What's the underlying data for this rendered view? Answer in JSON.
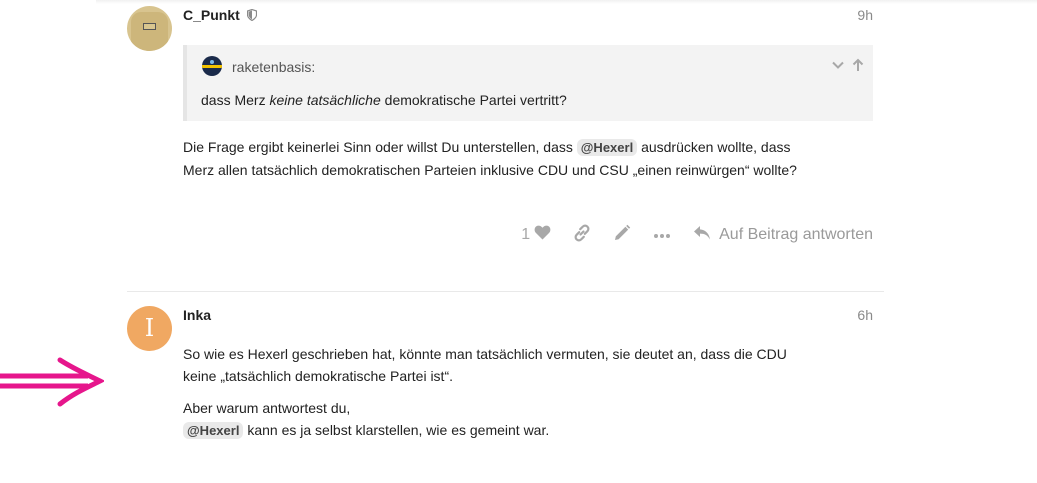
{
  "posts": [
    {
      "username": "C_Punkt",
      "time": "9h",
      "quote": {
        "author": "raketenbasis:",
        "text_before": "dass Merz ",
        "text_italic": "keine tatsächliche",
        "text_after": " demokratische Partei vertritt?"
      },
      "body": {
        "part1": "Die Frage ergibt keinerlei Sinn oder willst Du unterstellen, dass ",
        "mention": "@Hexerl",
        "part2": " ausdrücken wollte, dass",
        "line2": "Merz allen tatsächlich demokratischen Parteien inklusive CDU und CSU „einen reinwürgen“ wollte?"
      },
      "actions": {
        "like_count": "1",
        "reply_label": "Auf Beitrag antworten"
      }
    },
    {
      "username": "Inka",
      "avatar_letter": "I",
      "time": "6h",
      "body": {
        "para1_line1": "So wie es Hexerl geschrieben hat, könnte man tatsächlich vermuten, sie deutet an, dass die CDU",
        "para1_line2": "keine „tatsächlich demokratische Partei ist“.",
        "para2_line1": "Aber warum antwortest du,",
        "mention": "@Hexerl",
        "para2_line2_rest": " kann es ja selbst klarstellen, wie es gemeint war."
      }
    }
  ],
  "colors": {
    "accent_arrow": "#e6168c",
    "inka_avatar": "#f0a862",
    "muted": "#a8a8a8"
  },
  "icons": {
    "like": "heart-icon",
    "link": "link-icon",
    "edit": "pencil-icon",
    "more": "ellipsis-icon",
    "reply": "reply-icon",
    "moderator": "shield-icon",
    "quote_expand": "chevron-down-icon",
    "quote_jump": "arrow-up-icon"
  }
}
